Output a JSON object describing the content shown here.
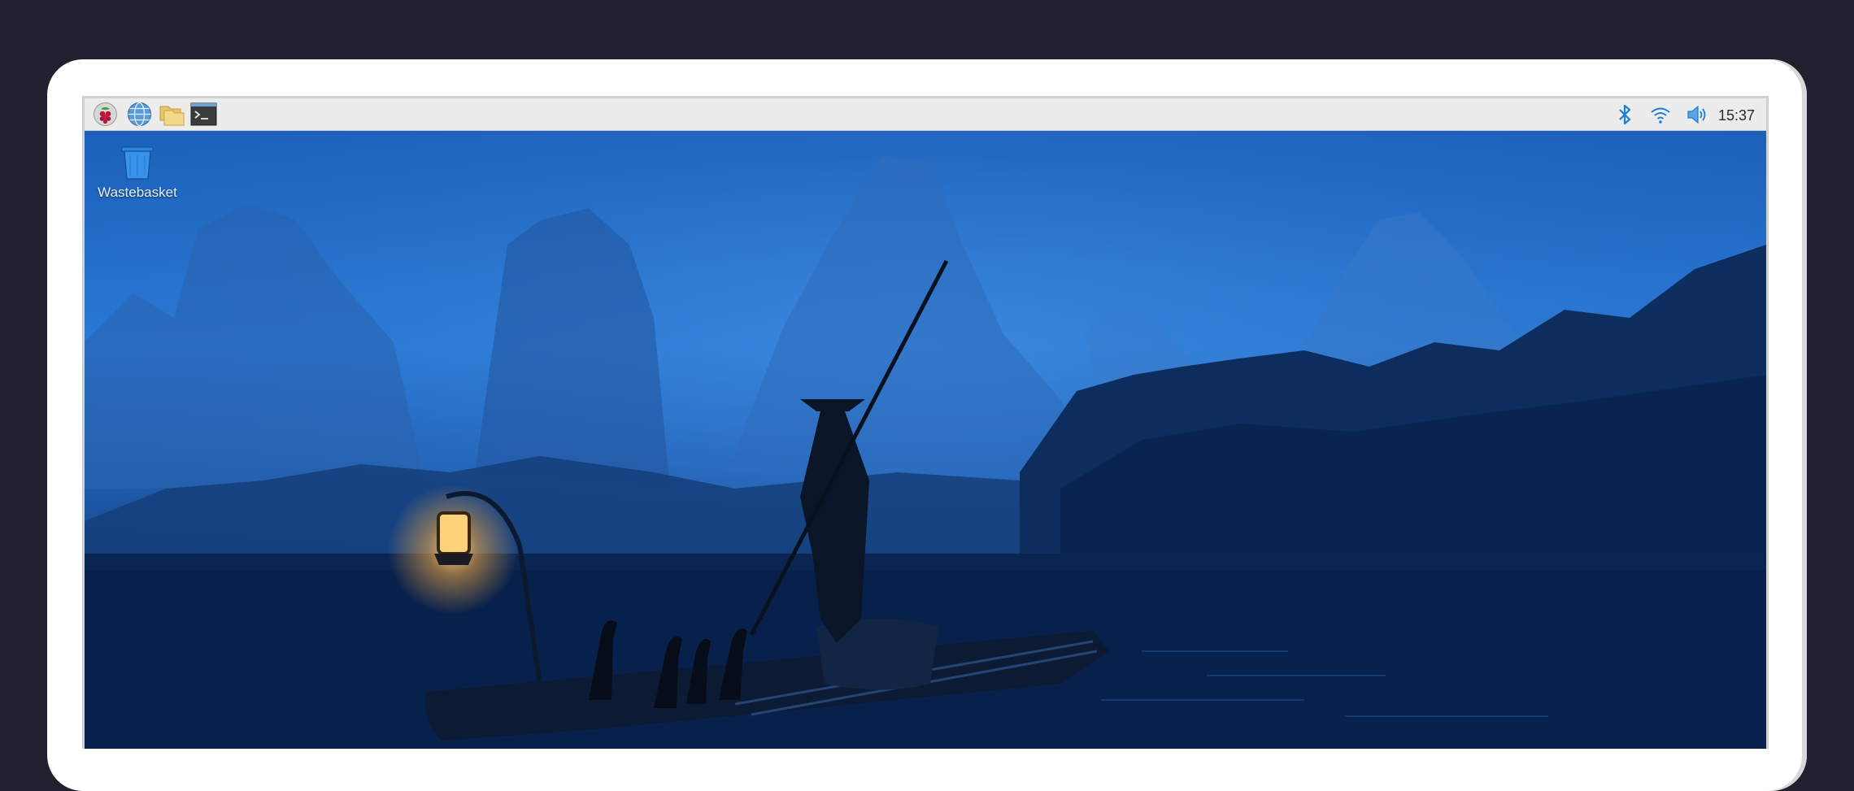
{
  "taskbar": {
    "launchers": [
      {
        "icon": "raspberry-menu-icon"
      },
      {
        "icon": "web-browser-icon"
      },
      {
        "icon": "file-manager-icon"
      },
      {
        "icon": "terminal-icon"
      }
    ],
    "tray": {
      "bluetooth_icon": "bluetooth-icon",
      "wifi_icon": "wifi-icon",
      "volume_icon": "volume-icon",
      "clock": "15:37"
    }
  },
  "desktop": {
    "icons": [
      {
        "label": "Wastebasket",
        "icon": "wastebasket-icon"
      }
    ]
  },
  "colors": {
    "taskbar_bg": "#ececec",
    "tray_accent": "#1a7fd6",
    "wallpaper_sky": "#2a7ad8",
    "wallpaper_water": "#071e44"
  }
}
